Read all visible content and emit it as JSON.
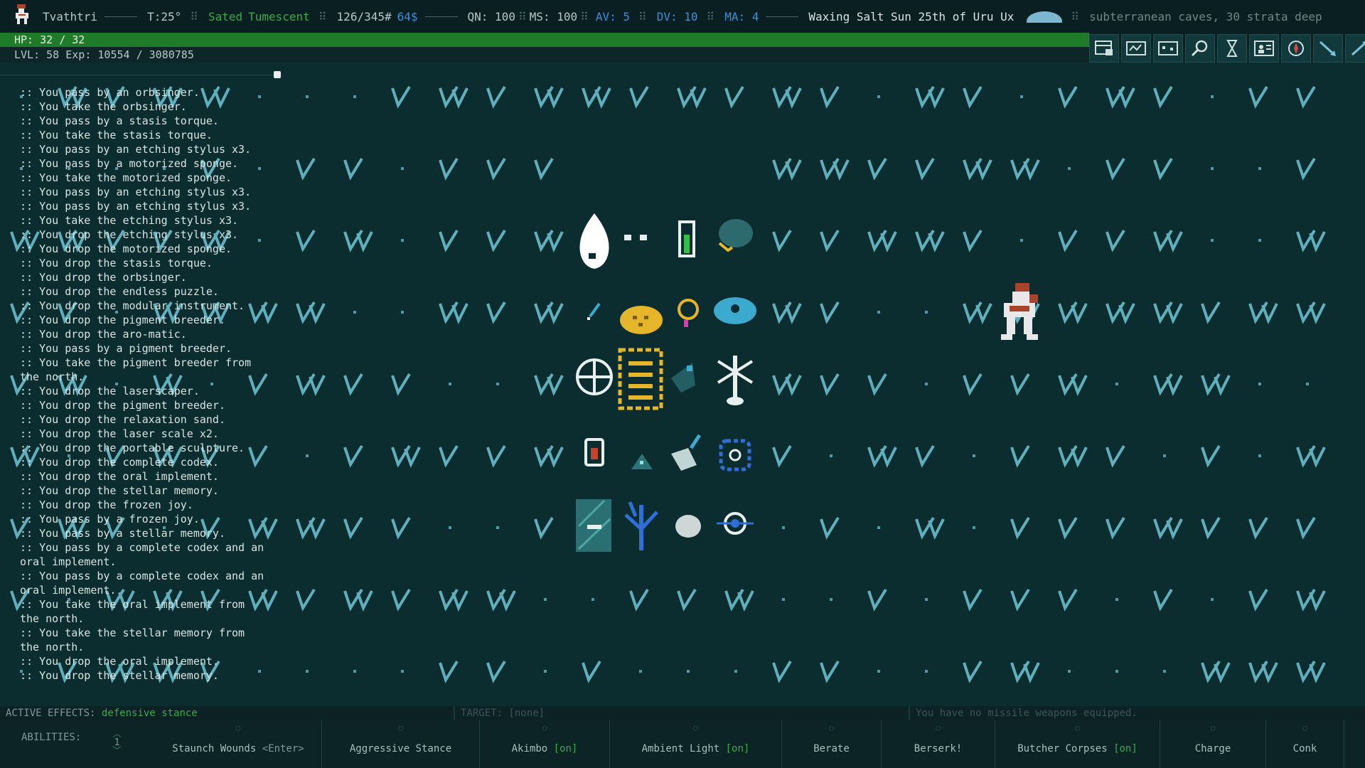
{
  "status": {
    "character_name": "Tvathtri",
    "temperature": "T:25°",
    "hunger": "Sated",
    "thirst": "Tumescent",
    "weight": "126/345#",
    "money": "64$",
    "qn": "QN: 100",
    "ms": "MS: 100",
    "av": "AV: 5",
    "dv": "DV: 10",
    "ma": "MA: 4",
    "date": "Waxing Salt Sun 25th of Uru Ux",
    "location": "subterranean caves, 30 strata deep"
  },
  "hp": {
    "label": "HP: 32 / 32",
    "fraction": 1.0
  },
  "level": {
    "label": "LVL: 58 Exp: 10554 / 3080785"
  },
  "toolbar": [
    {
      "icon": "journal-icon"
    },
    {
      "icon": "map-icon"
    },
    {
      "icon": "minimap-icon"
    },
    {
      "icon": "look-icon"
    },
    {
      "icon": "wait-icon"
    },
    {
      "icon": "character-icon"
    },
    {
      "icon": "compass-icon"
    },
    {
      "icon": "zoom-in-icon"
    },
    {
      "icon": "zoom-out-icon"
    }
  ],
  "log": [
    ":: You pass by an orbsinger.",
    ":: You take the orbsinger.",
    ":: You pass by a stasis torque.",
    ":: You take the stasis torque.",
    ":: You pass by an etching stylus x3.",
    ":: You pass by a motorized sponge.",
    ":: You take the motorized sponge.",
    ":: You pass by an etching stylus x3.",
    ":: You pass by an etching stylus x3.",
    ":: You take the etching stylus x3.",
    ":: You drop the etching stylus x3.",
    ":: You drop the motorized sponge.",
    ":: You drop the stasis torque.",
    ":: You drop the orbsinger.",
    ":: You drop the endless puzzle.",
    ":: You drop the modular instrument.",
    ":: You drop the pigment breeder.",
    ":: You drop the aro-matic.",
    ":: You pass by a pigment breeder.",
    ":: You take the pigment breeder from\nthe north.",
    ":: You drop the laserscaper.",
    ":: You drop the pigment breeder.",
    ":: You drop the relaxation sand.",
    ":: You drop the laser scale x2.",
    ":: You drop the portable sculpture.",
    ":: You drop the complete codex.",
    ":: You drop the oral implement.",
    ":: You drop the stellar memory.",
    ":: You drop the frozen joy.",
    ":: You pass by a frozen joy.",
    ":: You pass by a stellar memory.",
    ":: You pass by a complete codex and an\noral implement.",
    ":: You pass by a complete codex and an\noral implement.",
    ":: You take the oral implement from\nthe north.",
    ":: You take the stellar memory from\nthe north.",
    ":: You drop the oral implement.",
    ":: You drop the stellar memory."
  ],
  "effects": {
    "label": "ACTIVE EFFECTS:",
    "value": "defensive stance",
    "target": "TARGET: [none]",
    "missile": "You have no missile weapons equipped."
  },
  "abilities": {
    "label": "ABILITIES:",
    "page": "1",
    "items": [
      {
        "name": "Staunch Wounds",
        "key": "<Enter>",
        "state": ""
      },
      {
        "name": "Aggressive Stance",
        "key": "",
        "state": ""
      },
      {
        "name": "Akimbo",
        "key": "",
        "state": "[on]"
      },
      {
        "name": "Ambient Light",
        "key": "",
        "state": "[on]"
      },
      {
        "name": "Berate",
        "key": "",
        "state": ""
      },
      {
        "name": "Berserk!",
        "key": "",
        "state": ""
      },
      {
        "name": "Butcher Corpses",
        "key": "",
        "state": "[on]"
      },
      {
        "name": "Charge",
        "key": "",
        "state": ""
      },
      {
        "name": "Conk",
        "key": "",
        "state": ""
      }
    ]
  },
  "colors": {
    "background": "#0b2d2f",
    "grass": "#6fc7d6",
    "hp_bar": "#1f7a29",
    "item_gold": "#e5b52a",
    "item_blue": "#3ca9cf",
    "player_red": "#a8432c"
  }
}
